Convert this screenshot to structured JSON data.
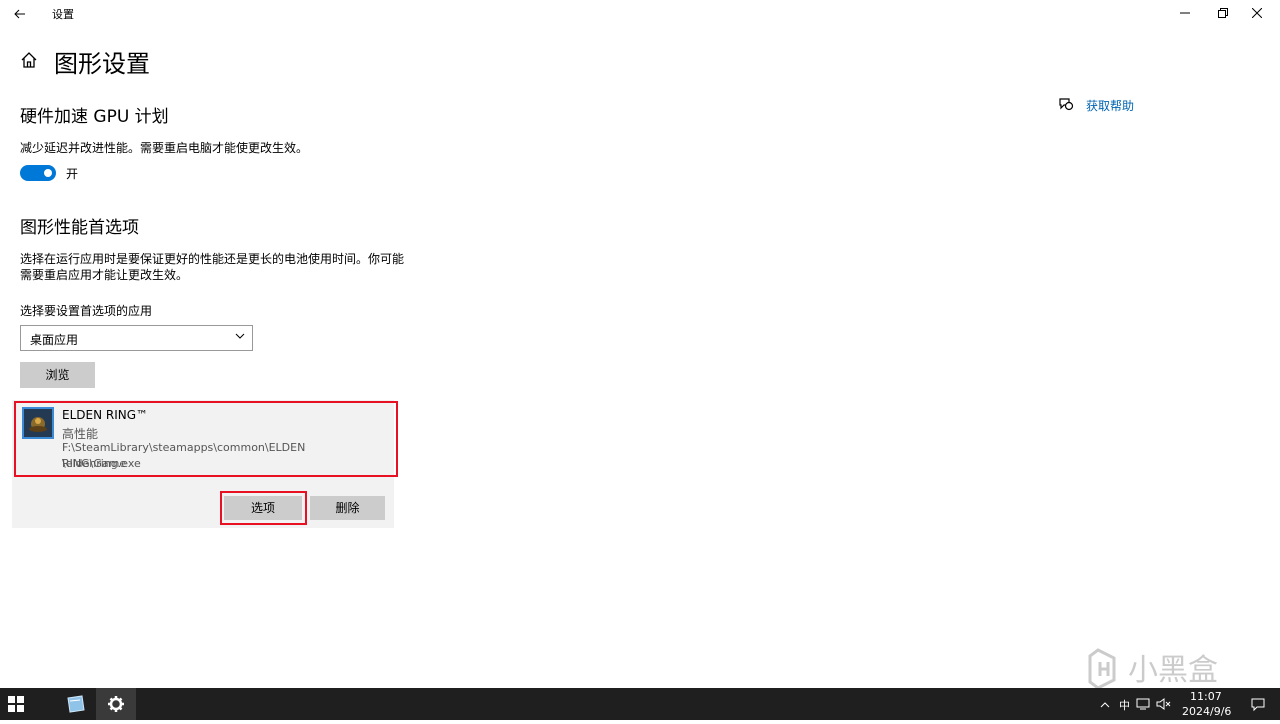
{
  "window": {
    "title": "设置",
    "back_icon": "back-arrow-icon",
    "minimize_icon": "minimize-icon",
    "restore_icon": "restore-icon",
    "close_icon": "close-icon"
  },
  "page": {
    "title": "图形设置",
    "help_link": "获取帮助"
  },
  "gpu_scheduling": {
    "heading": "硬件加速 GPU 计划",
    "description": "减少延迟并改进性能。需要重启电脑才能使更改生效。",
    "toggle_state": "开",
    "toggle_on": true
  },
  "graphics_pref": {
    "heading": "图形性能首选项",
    "description_line1": "选择在运行应用时是要保证更好的性能还是更长的电池使用时间。你可能",
    "description_line2": "需要重启应用才能让更改生效。",
    "select_label": "选择要设置首选项的应用",
    "select_value": "桌面应用",
    "browse_label": "浏览"
  },
  "app_entry": {
    "name": "ELDEN RING™",
    "preference": "高性能",
    "path_line1": "F:\\SteamLibrary\\steamapps\\common\\ELDEN RING\\Game",
    "path_line2": "\\eldenring.exe",
    "options_label": "选项",
    "delete_label": "删除"
  },
  "taskbar": {
    "ime_label": "中",
    "time": "11:07",
    "date": "2024/9/6"
  },
  "colors": {
    "accent": "#0078d7",
    "link": "#0063b1",
    "highlight": "#e81123"
  }
}
